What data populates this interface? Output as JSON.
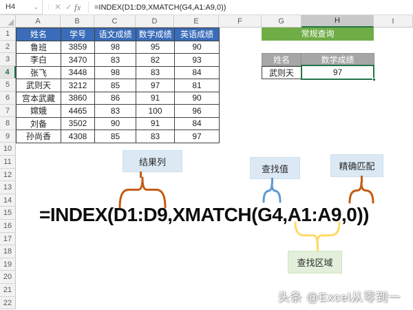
{
  "app": {
    "name_box": "H4",
    "formula_bar": "=INDEX(D1:D9,XMATCH(G4,A1:A9,0))",
    "icons": {
      "dropdown": "⌄",
      "dots": "⋮",
      "cancel": "✕",
      "enter": "✓",
      "fx": "fx"
    }
  },
  "spreadsheet": {
    "column_letters": [
      "A",
      "B",
      "C",
      "D",
      "E",
      "F",
      "G",
      "H",
      "I"
    ],
    "selected_column": "H",
    "row_numbers": [
      "1",
      "2",
      "3",
      "4",
      "5",
      "6",
      "7",
      "8",
      "9",
      "10",
      "11",
      "12",
      "13",
      "14",
      "15",
      "16",
      "17",
      "18",
      "19",
      "20",
      "21",
      "22"
    ],
    "selected_row": "4"
  },
  "table": {
    "headers": [
      "姓名",
      "学号",
      "语文成绩",
      "数学成绩",
      "英语成绩"
    ],
    "rows": [
      [
        "鲁班",
        "3859",
        "98",
        "95",
        "90"
      ],
      [
        "李白",
        "3470",
        "83",
        "82",
        "93"
      ],
      [
        "张飞",
        "3448",
        "98",
        "83",
        "84"
      ],
      [
        "武则天",
        "3212",
        "85",
        "97",
        "81"
      ],
      [
        "宫本武藏",
        "3860",
        "86",
        "91",
        "90"
      ],
      [
        "嫦娥",
        "4465",
        "83",
        "100",
        "96"
      ],
      [
        "刘备",
        "3502",
        "90",
        "91",
        "84"
      ],
      [
        "孙尚香",
        "4308",
        "85",
        "83",
        "97"
      ]
    ]
  },
  "query": {
    "title": "常规查询",
    "headers": [
      "姓名",
      "数学成绩"
    ],
    "lookup_name": "武则天",
    "result_value": "97"
  },
  "annotations": {
    "result_column": "结果列",
    "lookup_value": "查找值",
    "exact_match": "精确匹配",
    "lookup_range": "查找区域",
    "formula": "=INDEX(D1:D9,XMATCH(G4,A1:A9,0))"
  },
  "watermark": "头条 @Excel从零到一",
  "colors": {
    "header_blue": "#3a6cb9",
    "query_green": "#70ad47",
    "lookup_gray": "#a6a6a6",
    "selection_green": "#217346",
    "brace_orange": "#c55a11",
    "brace_blue": "#5b9bd5",
    "brace_yellow": "#ffd965",
    "label_blue_bg": "#dce9f5",
    "label_green_bg": "#e2efda"
  }
}
